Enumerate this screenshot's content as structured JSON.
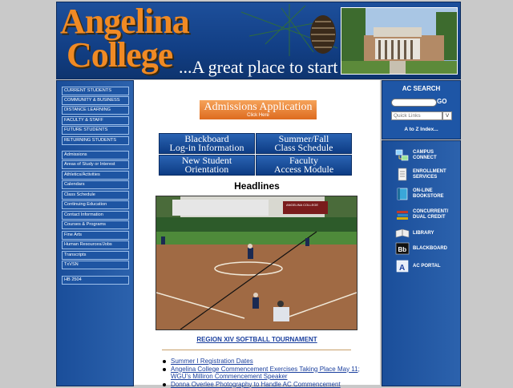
{
  "header": {
    "logo_line1": "Angelina",
    "logo_line2": "College",
    "tagline": "...A great place to start"
  },
  "left_nav": {
    "primary": [
      "CURRENT STUDENTS",
      "COMMUNITY & BUSINESS",
      "DISTANCE LEARNING",
      "FACULTY & STAFF",
      "FUTURE STUDENTS",
      "RETURNING STUDENTS"
    ],
    "secondary": [
      "Admissions",
      "Areas of Study or Interest",
      "Athletics/Activities",
      "Calendars",
      "Class Schedule",
      "Continuing Education",
      "Contact Information",
      "Courses & Programs",
      "Fine Arts",
      "Human Resources/Jobs",
      "Transcripts",
      "TxVSN"
    ],
    "extra": [
      "HB 2504"
    ]
  },
  "main": {
    "admissions_label": "Admissions Application",
    "admissions_sub": "Click Here",
    "buttons": [
      {
        "line1": "Blackboard",
        "line2": "Log-in Information"
      },
      {
        "line1": "Summer/Fall",
        "line2": "Class Schedule"
      },
      {
        "line1": "New Student",
        "line2": "Orientation"
      },
      {
        "line1": "Faculty",
        "line2": "Access Module"
      }
    ],
    "headlines_title": "Headlines",
    "photo_caption": "REGION XIV SOFTBALL TOURNAMENT",
    "news": [
      "Summer I Registration Dates",
      "Angelina College Commencement Exercises Taking Place May 11; WGU's Milliron Commencement Speaker",
      "Donna Overlee Photography to Handle AC Commencement"
    ]
  },
  "right": {
    "search_title": "AC SEARCH",
    "go_label": "GO",
    "quick_links_placeholder": "Quick Links",
    "quick_links_arrow": "V",
    "atoz_label": "A to Z Index...",
    "links": [
      {
        "label": "CAMPUS\nCONNECT",
        "icon": "campus-connect-icon"
      },
      {
        "label": "ENROLLMENT\nSERVICES",
        "icon": "document-icon"
      },
      {
        "label": "ON-LINE\nBOOKSTORE",
        "icon": "book-icon"
      },
      {
        "label": "CONCURRENT/\nDUAL CREDIT",
        "icon": "books-stack-icon"
      },
      {
        "label": "LIBRARY",
        "icon": "open-book-icon"
      },
      {
        "label": "BLACKBOARD",
        "icon": "blackboard-icon",
        "icon_text": "Bb"
      },
      {
        "label": "AC PORTAL",
        "icon": "portal-icon",
        "icon_text": "A"
      }
    ]
  },
  "scoreboard": {
    "text": "ANGELINA COLLEGE"
  },
  "colors": {
    "brand_orange": "#f08a24",
    "nav_blue": "#1e56a6",
    "link_blue": "#1a3f9e"
  }
}
